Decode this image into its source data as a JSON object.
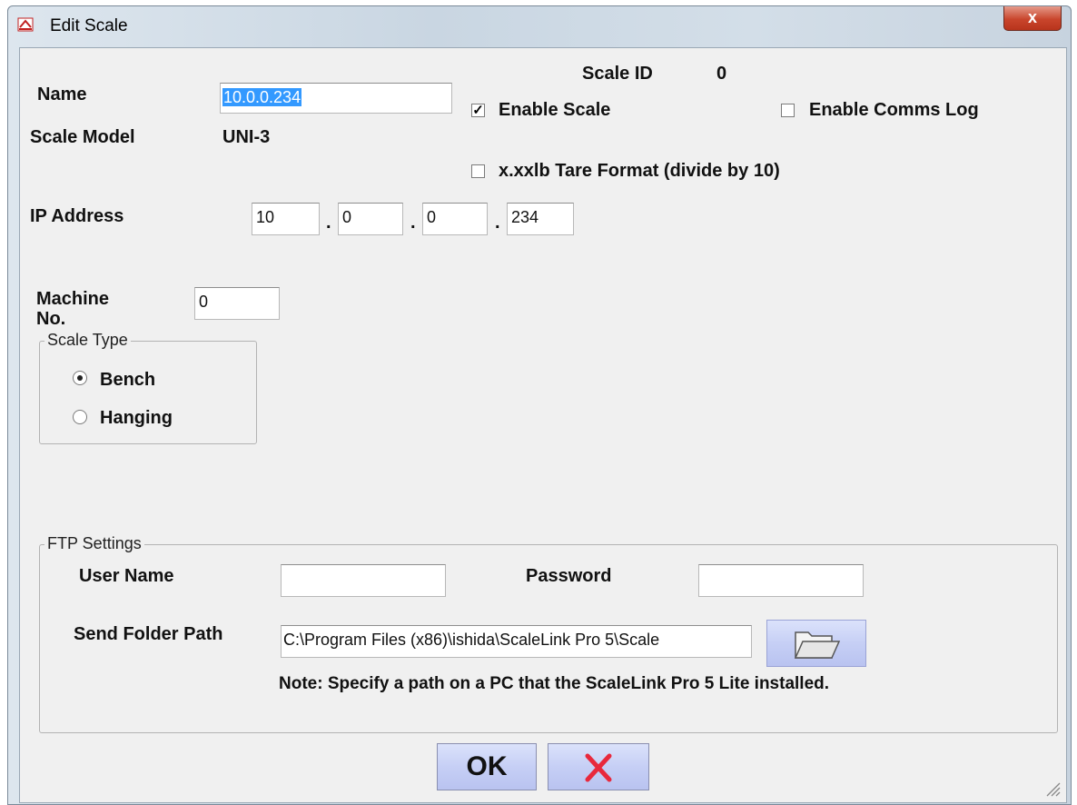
{
  "window": {
    "title": "Edit Scale",
    "close_label": "x"
  },
  "form": {
    "name_label": "Name",
    "name_value": "10.0.0.234",
    "scale_id_label": "Scale ID",
    "scale_id_value": "0",
    "enable_scale_label": "Enable Scale",
    "enable_scale_checked": true,
    "enable_comms_log_label": "Enable Comms Log",
    "enable_comms_log_checked": false,
    "scale_model_label": "Scale Model",
    "scale_model_value": "UNI-3",
    "tare_format_label": "x.xxlb Tare Format (divide by 10)",
    "tare_format_checked": false,
    "ip_label": "IP Address",
    "ip_octets": [
      "10",
      "0",
      "0",
      "234"
    ],
    "ip_separator": ".",
    "machine_no_label_1": "Machine",
    "machine_no_label_2": "No.",
    "machine_no_value": "0"
  },
  "scale_type": {
    "legend": "Scale Type",
    "options": [
      {
        "label": "Bench",
        "selected": true
      },
      {
        "label": "Hanging",
        "selected": false
      }
    ]
  },
  "ftp": {
    "legend": "FTP Settings",
    "user_name_label": "User Name",
    "user_name_value": "",
    "password_label": "Password",
    "password_value": "",
    "send_folder_label": "Send Folder Path",
    "send_folder_value": "C:\\Program Files (x86)\\ishida\\ScaleLink Pro 5\\Scale",
    "browse_icon": "folder-icon",
    "note": "Note: Specify a path on a PC that the ScaleLink Pro 5 Lite installed."
  },
  "buttons": {
    "ok_label": "OK",
    "cancel_icon": "red-x-icon"
  },
  "colors": {
    "close_button": "#c9452c",
    "cancel_x": "#e8283c",
    "selection": "#3399ff"
  }
}
